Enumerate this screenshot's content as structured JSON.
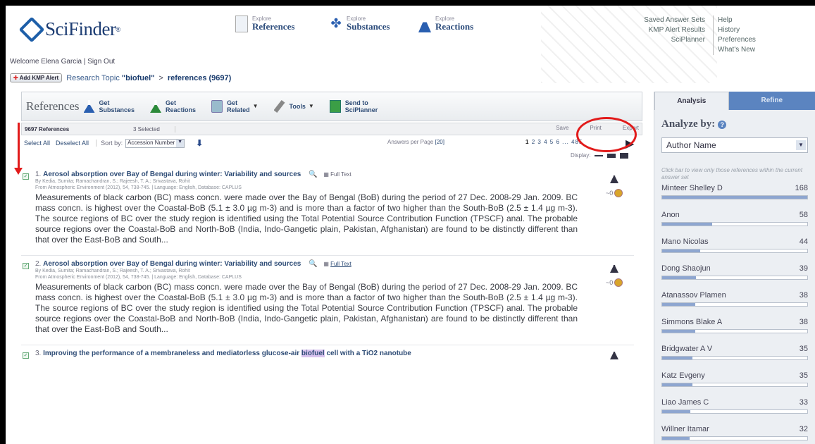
{
  "header": {
    "logo_text": "SciFinder",
    "logo_reg": "®",
    "explore": [
      {
        "small": "Explore",
        "big": "References"
      },
      {
        "small": "Explore",
        "big": "Substances"
      },
      {
        "small": "Explore",
        "big": "Reactions"
      }
    ],
    "right_links_col1": [
      "Saved Answer Sets",
      "KMP Alert Results",
      "SciPlanner"
    ],
    "right_links_col2": [
      "Help",
      "History",
      "Preferences",
      "What's New"
    ],
    "welcome": "Welcome Elena Garcia",
    "sign_out": "Sign Out",
    "breadcrumb": {
      "kmp_button": "Add KMP Alert",
      "topic_label": "Research Topic",
      "topic_query": "\"biofuel\"",
      "separator": ">",
      "current": "references (9697)"
    }
  },
  "toolbar": {
    "title": "References",
    "items": [
      {
        "line1": "Get",
        "line2": "Substances"
      },
      {
        "line1": "Get",
        "line2": "Reactions"
      },
      {
        "line1": "Get",
        "line2": "Related"
      },
      {
        "line1": "Tools",
        "line2": ""
      },
      {
        "line1": "Send to",
        "line2": "SciPlanner"
      }
    ]
  },
  "status": {
    "count": "9697 References",
    "selected": "3 Selected",
    "save": "Save",
    "print": "Print",
    "export": "Export"
  },
  "sort": {
    "select_all": "Select All",
    "deselect_all": "Deselect All",
    "sort_by_label": "Sort by:",
    "sort_by_value": "Accession Number",
    "answers_per_page_label": "Answers per Page",
    "answers_per_page_value": "[20]",
    "pages": [
      "1",
      "2",
      "3",
      "4",
      "5",
      "6",
      "...",
      "485"
    ],
    "display_label": "Display:"
  },
  "results": [
    {
      "num": "1.",
      "title": "Aerosol absorption over Bay of Bengal during winter: Variability and sources",
      "full_text": "Full Text",
      "authors": "By Kedia, Sumita; Ramachandran, S.; Rajeesh, T. A.; Srivastava, Rohit",
      "source": "From Atmospheric Environment (2012), 54, 738-745.  |  Language: English, Database: CAPLUS",
      "abstract": "Measurements of black carbon (BC) mass concn. were made over the Bay of Bengal (BoB) during the period of 27 Dec. 2008-29 Jan. 2009.  BC mass concn. is highest over the Coastal-BoB (5.1 ± 3.0 µg m-3) and is more than a factor of two higher than the South-BoB (2.5 ± 1.4 µg m-3).  The source regions of BC over the study region is identified using the Total Potential Source Contribution Function (TPSCF) anal.  The probable source regions over the Coastal-BoB and North-BoB (India, Indo-Gangetic plain, Pakistan, Afghanistan) are found to be distinctly different than that over the East-BoB and South...",
      "cited": "~0"
    },
    {
      "num": "2.",
      "title": "Aerosol absorption over Bay of Bengal during winter: Variability and sources",
      "full_text": "Full Text",
      "authors": "By Kedia, Sumita; Ramachandran, S.; Rajeesh, T. A.; Srivastava, Rohit",
      "source": "From Atmospheric Environment (2012), 54, 738-745.  |  Language: English, Database: CAPLUS",
      "abstract": "Measurements of black carbon (BC) mass concn. were made over the Bay of Bengal (BoB) during the period of 27 Dec. 2008-29 Jan. 2009.  BC mass concn. is highest over the Coastal-BoB (5.1 ± 3.0 µg m-3) and is more than a factor of two higher than the South-BoB (2.5 ± 1.4 µg m-3).  The source regions of BC over the study region is identified using the Total Potential Source Contribution Function (TPSCF) anal.  The probable source regions over the Coastal-BoB and North-BoB (India, Indo-Gangetic plain, Pakistan, Afghanistan) are found to be distinctly different than that over the East-BoB and South...",
      "cited": "~0"
    },
    {
      "num": "3.",
      "title_pre": "Improving the performance of a membraneless and mediatorless glucose-air ",
      "title_hl": "biofuel",
      "title_post": " cell with a TiO2 nanotube"
    }
  ],
  "analysis": {
    "tab_active": "Analysis",
    "tab_inactive": "Refine",
    "analyze_by": "Analyze by:",
    "select_value": "Author Name",
    "hint": "Click bar to view only those references within the current answer set",
    "max": 168,
    "rows": [
      {
        "name": "Minteer Shelley D",
        "count": 168
      },
      {
        "name": "Anon",
        "count": 58
      },
      {
        "name": "Mano Nicolas",
        "count": 44
      },
      {
        "name": "Dong Shaojun",
        "count": 39
      },
      {
        "name": "Atanassov Plamen",
        "count": 38
      },
      {
        "name": "Simmons Blake A",
        "count": 38
      },
      {
        "name": "Bridgwater A V",
        "count": 35
      },
      {
        "name": "Katz Evgeny",
        "count": 35
      },
      {
        "name": "Liao James C",
        "count": 33
      },
      {
        "name": "Willner Itamar",
        "count": 32
      }
    ]
  },
  "colors": {
    "annotation_red": "#e21b1b",
    "link_blue": "#2e4c76",
    "tab_blue": "#5b84c0"
  }
}
